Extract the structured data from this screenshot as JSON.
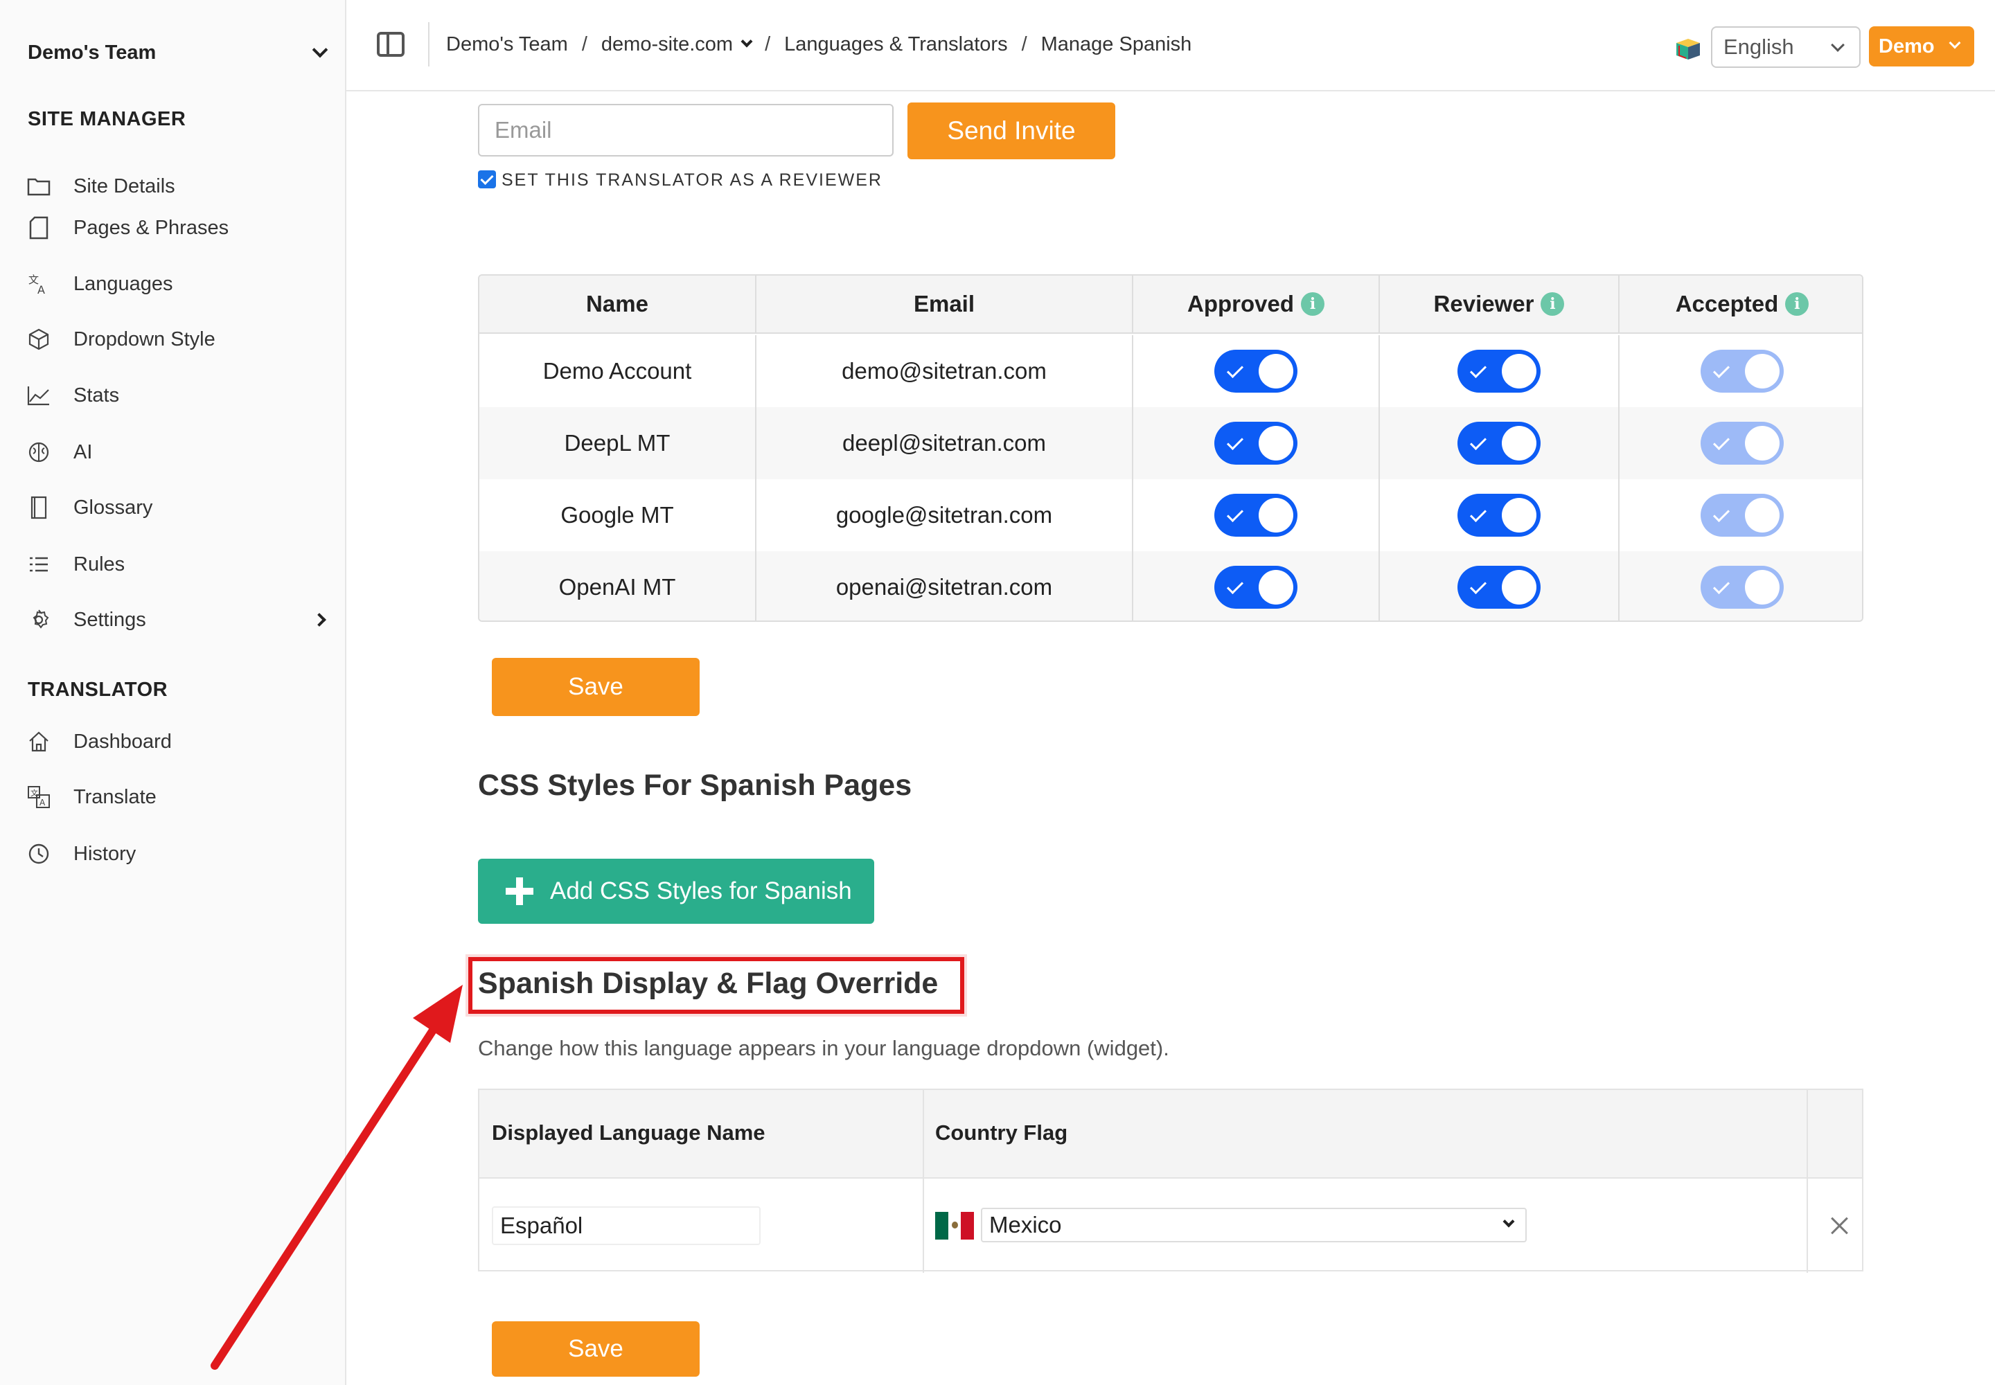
{
  "sidebar": {
    "team": "Demo's Team",
    "site_manager_title": "SITE MANAGER",
    "site_manager_items": [
      {
        "label": "Site Details",
        "icon": "folder-icon"
      },
      {
        "label": "Pages & Phrases",
        "icon": "page-icon"
      },
      {
        "label": "Languages",
        "icon": "translate-icon"
      },
      {
        "label": "Dropdown Style",
        "icon": "box-icon"
      },
      {
        "label": "Stats",
        "icon": "chart-line-icon"
      },
      {
        "label": "AI",
        "icon": "brain-icon"
      },
      {
        "label": "Glossary",
        "icon": "book-icon"
      },
      {
        "label": "Rules",
        "icon": "list-icon"
      },
      {
        "label": "Settings",
        "icon": "gear-icon"
      }
    ],
    "translator_title": "TRANSLATOR",
    "translator_items": [
      {
        "label": "Dashboard",
        "icon": "home-icon"
      },
      {
        "label": "Translate",
        "icon": "translate-doc-icon"
      },
      {
        "label": "History",
        "icon": "clock-icon"
      }
    ]
  },
  "topbar": {
    "breadcrumb": [
      "Demo's Team",
      "demo-site.com",
      "Languages & Translators",
      "Manage Spanish"
    ],
    "language": "English",
    "user": "Demo"
  },
  "invite": {
    "email_placeholder": "Email",
    "send_label": "Send Invite",
    "reviewer_label": "SET THIS TRANSLATOR AS A REVIEWER",
    "reviewer_checked": true
  },
  "translators_table": {
    "headers": [
      "Name",
      "Email",
      "Approved",
      "Reviewer",
      "Accepted"
    ],
    "rows": [
      {
        "name": "Demo Account",
        "email": "demo@sitetran.com",
        "approved": true,
        "reviewer": true,
        "accepted": true
      },
      {
        "name": "DeepL MT",
        "email": "deepl@sitetran.com",
        "approved": true,
        "reviewer": true,
        "accepted": true
      },
      {
        "name": "Google MT",
        "email": "google@sitetran.com",
        "approved": true,
        "reviewer": true,
        "accepted": true
      },
      {
        "name": "OpenAI MT",
        "email": "openai@sitetran.com",
        "approved": true,
        "reviewer": true,
        "accepted": true
      }
    ],
    "info_glyph": "i"
  },
  "save_label": "Save",
  "css_section": {
    "title": "CSS Styles For Spanish Pages",
    "add_button": "Add CSS Styles for Spanish"
  },
  "override_section": {
    "title": "Spanish Display & Flag Override",
    "description": "Change how this language appears in your language dropdown (widget).",
    "col_name": "Displayed Language Name",
    "col_flag": "Country Flag",
    "name_value": "Español",
    "country_value": "Mexico"
  },
  "colors": {
    "accent_orange": "#f7941d",
    "toggle_blue": "#0d5cf5",
    "green": "#2aae8c",
    "annotation_red": "#e0191c"
  }
}
